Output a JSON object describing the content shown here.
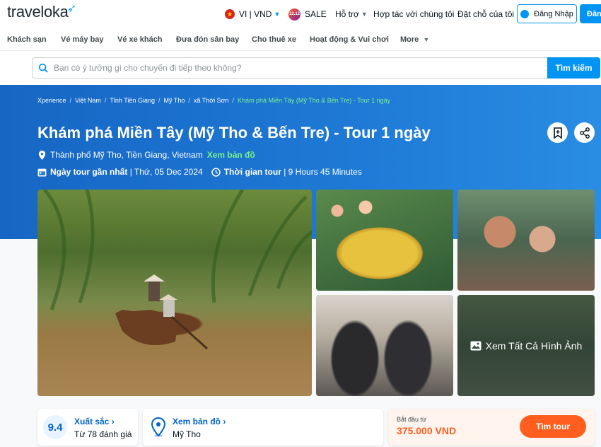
{
  "header": {
    "logo_text": "traveloka",
    "lang_currency": "VI | VND",
    "sale_badge": "12.12",
    "sale": "SALE",
    "support": "Hỗ trợ",
    "partner": "Hợp tác với chúng tôi",
    "my_bookings": "Đặt chỗ của tôi",
    "login": "Đăng Nhập",
    "register": "Đăng"
  },
  "categories": [
    "Khách sạn",
    "Vé máy bay",
    "Vé xe khách",
    "Đưa đón sân bay",
    "Cho thuê xe",
    "Hoạt động & Vui chơi",
    "More"
  ],
  "search": {
    "placeholder": "Bạn có ý tưởng gì cho chuyến đi tiếp theo không?",
    "button": "Tìm kiếm"
  },
  "breadcrumbs": [
    "Xperience",
    "Việt Nam",
    "Tỉnh Tiền Giang",
    "Mỹ Tho",
    "xã Thới Sơn"
  ],
  "breadcrumb_current": "Khám phá Miền Tây (Mỹ Tho & Bến Tre) - Tour 1 ngày",
  "tour": {
    "title": "Khám phá Miền Tây (Mỹ Tho & Bến Tre) - Tour 1 ngày",
    "location": "Thành phố Mỹ Tho, Tiền Giang, Vietnam",
    "map_link": "Xem bản đồ",
    "nearest_label": "Ngày tour gần nhất",
    "nearest_value": "| Thứ, 05 Dec 2024",
    "duration_label": "Thời gian tour",
    "duration_value": "| 9 Hours 45 Minutes"
  },
  "gallery": {
    "view_all": "Xem Tất Cả Hình Ảnh"
  },
  "rating": {
    "score": "9.4",
    "label": "Xuất sắc",
    "count": "Từ 78 đánh giá"
  },
  "map_card": {
    "label": "Xem bản đồ",
    "city": "Mỹ Tho"
  },
  "price_card": {
    "start_label": "Bắt đầu từ",
    "price": "375.000 VND",
    "button": "Tìm tour"
  },
  "colors": {
    "brand_blue": "#0194f3",
    "hero_blue": "#1e7ad6",
    "accent_green": "#7cf08a",
    "orange": "#ff5e1f"
  }
}
